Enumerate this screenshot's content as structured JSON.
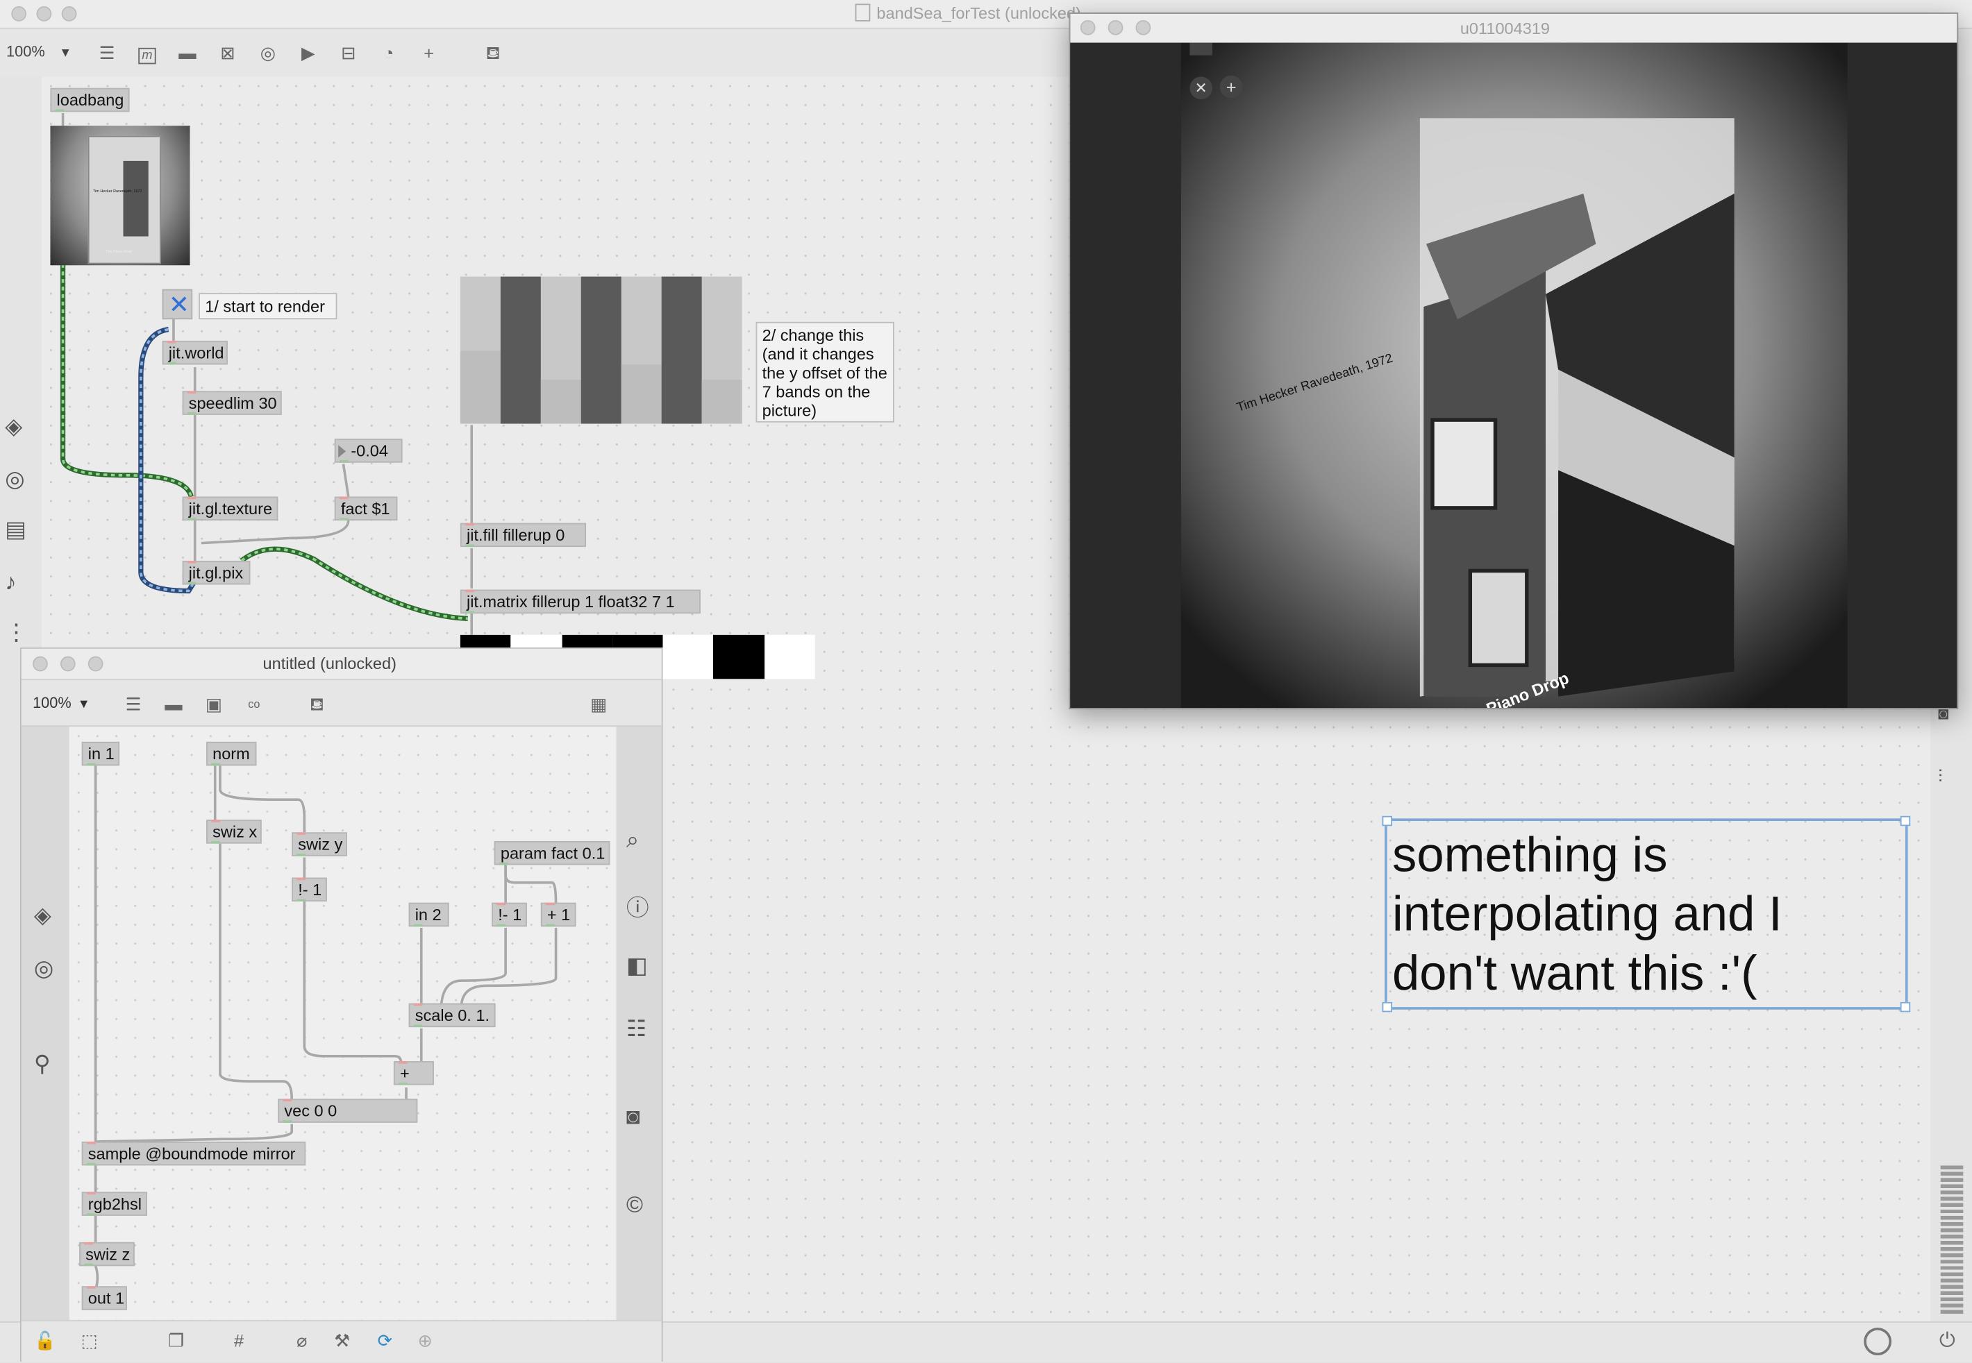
{
  "main_window": {
    "title": "bandSea_forTest (unlocked)",
    "zoom": "100%"
  },
  "patch": {
    "loadbang": "loadbang",
    "start_comment": "1/ start to render",
    "jit_world": "jit.world",
    "speedlim": "speedlim 30",
    "number_value": "-0.04",
    "jit_gl_texture": "jit.gl.texture",
    "fact_msg": "fact $1",
    "jit_gl_pix": "jit.gl.pix",
    "jit_fill": "jit.fill fillerup 0",
    "jit_matrix": "jit.matrix fillerup 1 float32 7 1",
    "change_comment": "2/ change this (and it changes the y offset of the 7 bands on the picture)",
    "multislider_values": [
      0.5,
      1.0,
      0.3,
      1.0,
      0.4,
      1.0,
      0.3
    ],
    "matrix_view_cells": [
      "#000000",
      "#ffffff",
      "#000000",
      "#000000",
      "#ffffff",
      "#000000",
      "#ffffff"
    ],
    "note_comment": "something is interpolating and I don't want this :'("
  },
  "sub_window": {
    "title": "untitled (unlocked)",
    "zoom": "100%",
    "objects": {
      "in1": "in 1",
      "norm": "norm",
      "swiz_x": "swiz x",
      "swiz_y": "swiz y",
      "not_minus_1a": "!- 1",
      "param_fact": "param fact 0.1",
      "in2": "in 2",
      "not_minus_1b": "!- 1",
      "plus_1": "+ 1",
      "scale": "scale 0. 1.",
      "plus": "+",
      "vec": "vec 0 0",
      "sample": "sample @boundmode mirror",
      "rgb2hsl": "rgb2hsl",
      "swiz_z": "swiz z",
      "out1": "out 1"
    }
  },
  "viewer_window": {
    "title": "u011004319",
    "album_text": "Tim Hecker Ravedeath, 1972",
    "album_title": "The Piano Drop",
    "album_artist": "Tim Hecker"
  },
  "thumbnail": {
    "album_title": "The Piano Drop",
    "caption": "Tim Hecker Ravedeath, 1972"
  }
}
